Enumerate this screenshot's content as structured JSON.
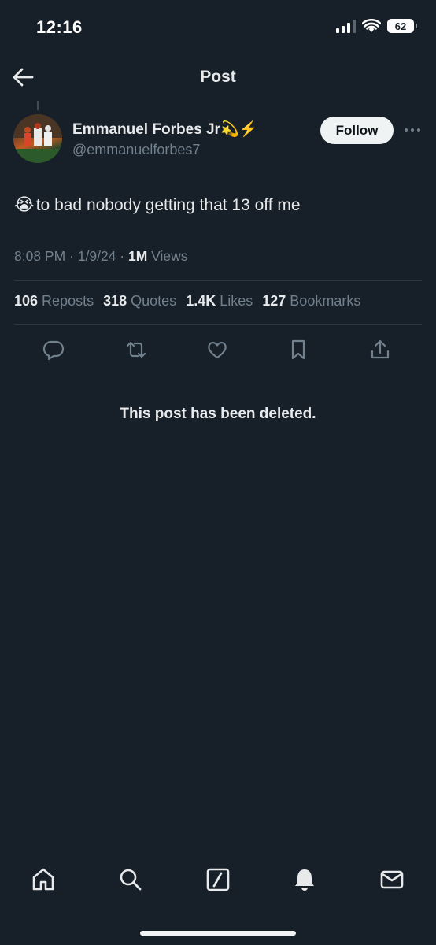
{
  "status_bar": {
    "time": "12:16",
    "battery": "62",
    "icons": [
      "signal-icon",
      "wifi-icon",
      "battery-icon"
    ]
  },
  "nav": {
    "title": "Post",
    "back_icon": "arrow-left-icon"
  },
  "post": {
    "author_name": "Emmanuel Forbes Jr💫⚡️",
    "author_handle": "@emmanuelforbes7",
    "follow_label": "Follow",
    "text_emoji": "😭",
    "text": "to bad nobody getting that 13 off me",
    "time": "8:08 PM",
    "date": "1/9/24",
    "views_count": "1M",
    "views_label": "Views"
  },
  "stats": [
    {
      "count": "106",
      "label": "Reposts"
    },
    {
      "count": "318",
      "label": "Quotes"
    },
    {
      "count": "1.4K",
      "label": "Likes"
    },
    {
      "count": "127",
      "label": "Bookmarks"
    }
  ],
  "actions": [
    "reply-icon",
    "repost-icon",
    "like-icon",
    "bookmark-icon",
    "share-icon"
  ],
  "deleted_notice": "This post has been deleted.",
  "tabbar": [
    "home-icon",
    "search-icon",
    "grok-icon",
    "notifications-icon",
    "messages-icon"
  ],
  "colors": {
    "background": "#172029",
    "text_primary": "#e7e9ea",
    "text_secondary": "#71808d",
    "follow_bg": "#eff3f4"
  }
}
